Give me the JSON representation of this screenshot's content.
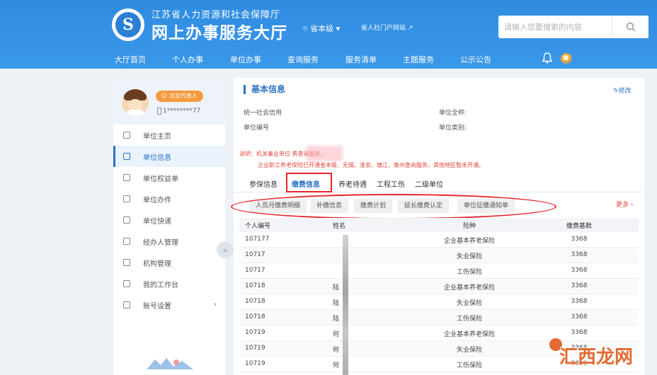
{
  "header": {
    "dept_name": "江苏省人力资源和社会保障厅",
    "hall_name": "网上办事服务大厅",
    "level_select": "省本级",
    "personal_portal": "省人社门户网站",
    "search_placeholder": "请输入您要搜索的内容"
  },
  "nav": [
    "大厅首页",
    "个人办事",
    "单位办事",
    "查询服务",
    "服务清单",
    "主题服务",
    "公示公告"
  ],
  "sidebar": {
    "role_badge": "法定代表人",
    "phone": "1********77",
    "items": [
      {
        "label": "单位主页"
      },
      {
        "label": "单位信息"
      },
      {
        "label": "单位权益单"
      },
      {
        "label": "单位办件"
      },
      {
        "label": "单位快递"
      },
      {
        "label": "经办人管理"
      },
      {
        "label": "机构管理"
      },
      {
        "label": "我的工作台"
      },
      {
        "label": "账号设置"
      }
    ]
  },
  "main": {
    "section_title": "基本信息",
    "edit": "修改",
    "fields": {
      "credit_code_label": "统一社会信用",
      "unit_number_label": "单位编号",
      "full_name_label": "单位全称:",
      "category_label": "单位类别:"
    },
    "notice_line1": "说明：机关事业单位                               费查询服务。",
    "notice_line2": "企业职工养老保险已开通省本级、无锡、淮安、镇江、泰州查询服务，其他地区暂未开通。",
    "tabs": [
      "参保信息",
      "缴费信息",
      "养老待遇",
      "工程工伤",
      "二级单位"
    ],
    "subtabs": [
      "人员月缴费明细",
      "补缴信息",
      "缴费计划",
      "延长缴费认定",
      "单位征缴通知单"
    ],
    "more": "更多",
    "table": {
      "headers": [
        "个人编号",
        "姓名",
        "险种",
        "缴费基数"
      ],
      "rows": [
        [
          "107177",
          "",
          "企业基本养老保险",
          "3368"
        ],
        [
          "10717",
          "",
          "失业保险",
          "3368"
        ],
        [
          "10717",
          "",
          "工伤保险",
          "3368"
        ],
        [
          "10718",
          "陆",
          "企业基本养老保险",
          "3368"
        ],
        [
          "10718",
          "陆",
          "失业保险",
          "3368"
        ],
        [
          "10718",
          "陆",
          "工伤保险",
          "3368"
        ],
        [
          "10719",
          "何",
          "企业基本养老保险",
          "3368"
        ],
        [
          "10719",
          "何",
          "失业保险",
          "3368"
        ],
        [
          "10719",
          "何",
          "工伤保险",
          "3368"
        ]
      ]
    }
  },
  "watermark": "汇西龙网"
}
